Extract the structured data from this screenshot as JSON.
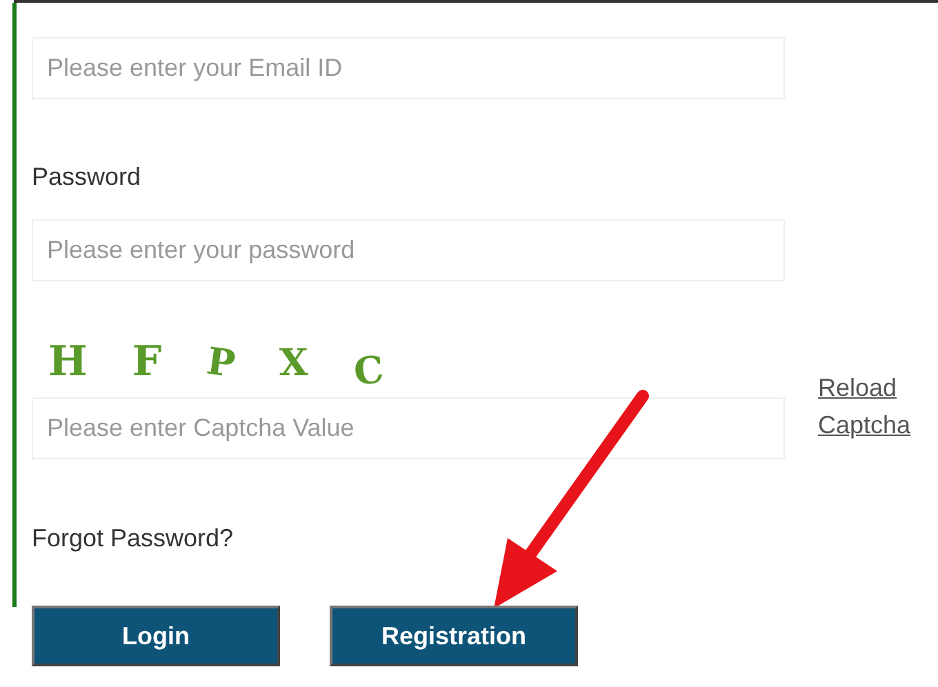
{
  "email": {
    "placeholder": "Please enter your Email ID"
  },
  "password": {
    "label": "Password",
    "placeholder": "Please enter your password"
  },
  "captcha": {
    "code": "H F P X C",
    "placeholder": "Please enter Captcha Value",
    "reload_link": "Reload Captcha"
  },
  "forgot_link": "Forgot Password?",
  "buttons": [
    {
      "label": "Login"
    },
    {
      "label": "Registration"
    }
  ]
}
